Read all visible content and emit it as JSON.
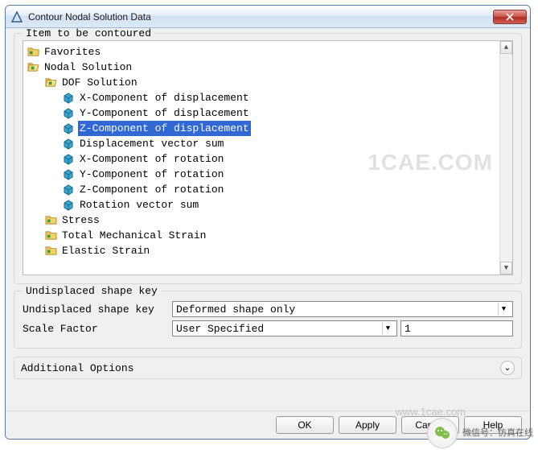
{
  "window": {
    "title": "Contour Nodal Solution Data"
  },
  "fieldset1": {
    "legend": "Item to be contoured"
  },
  "tree": {
    "favorites": "Favorites",
    "nodal": "Nodal Solution",
    "dof": "DOF Solution",
    "items": [
      "X-Component of displacement",
      "Y-Component of displacement",
      "Z-Component of displacement",
      "Displacement vector sum",
      "X-Component of rotation",
      "Y-Component of rotation",
      "Z-Component of rotation",
      "Rotation vector sum"
    ],
    "stress": "Stress",
    "tms": "Total Mechanical Strain",
    "es": "Elastic Strain"
  },
  "fieldset2": {
    "legend": "Undisplaced shape key",
    "row1_label": "Undisplaced shape key",
    "row1_value": "Deformed shape only",
    "row2_label": "Scale Factor",
    "row2_value": "User Specified",
    "row2_input": "1"
  },
  "addl": {
    "label": "Additional Options"
  },
  "buttons": {
    "ok": "OK",
    "apply": "Apply",
    "cancel": "Cancel",
    "help": "Help"
  },
  "watermark": "1CAE.COM",
  "site": "www.1cae.com",
  "overlay": {
    "line1": "微信号：仿真在线"
  }
}
